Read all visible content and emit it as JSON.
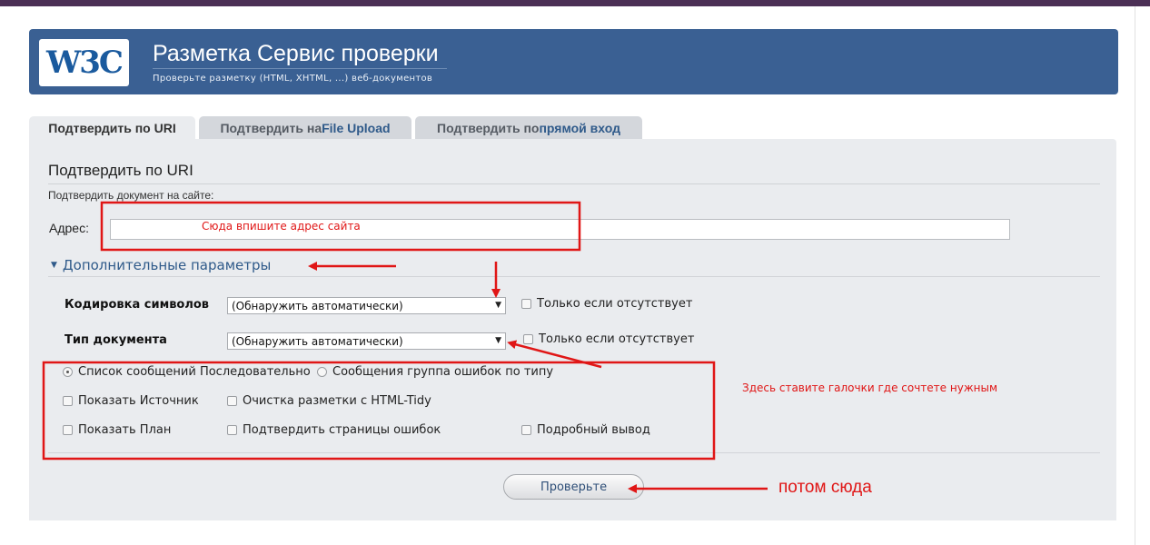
{
  "header": {
    "logo_text": "W3C",
    "title": "Разметка Сервис проверки",
    "subtitle": "Проверьте разметку (HTML, XHTML, ...) веб-документов"
  },
  "tabs": [
    {
      "label_a": "Подтвердить по URI",
      "label_b": ""
    },
    {
      "label_a": "Подтвердить на ",
      "label_b": "File Upload"
    },
    {
      "label_a": "Подтвердить по ",
      "label_b": "прямой вход"
    }
  ],
  "form": {
    "section_title": "Подтвердить по URI",
    "section_desc": "Подтвердить документ на сайте:",
    "address_label": "Адрес:",
    "address_value": "",
    "more_options_label": "Дополнительные параметры",
    "charset_label": "Кодировка символов",
    "charset_value": "(Обнаружить автоматически)",
    "charset_only_if_missing": "Только если отсутствует",
    "doctype_label": "Тип документа",
    "doctype_value": "(Обнаружить автоматически)",
    "doctype_only_if_missing": "Только если отсутствует",
    "radio_sequential": "Список сообщений Последовательно",
    "radio_grouped": "Сообщения группа ошибок по типу",
    "show_source": "Показать Источник",
    "cleanup_tidy": "Очистка разметки с HTML-Tidy",
    "show_outline": "Показать План",
    "validate_error_pages": "Подтвердить страницы ошибок",
    "verbose_output": "Подробный вывод",
    "check_button": "Проверьте"
  },
  "annotations": {
    "address_note": "Сюда впишите адрес сайта",
    "checkbox_note": "Здесь ставите галочки где сочтете нужным",
    "then_note": "потом сюда",
    "color": "#e01616"
  }
}
